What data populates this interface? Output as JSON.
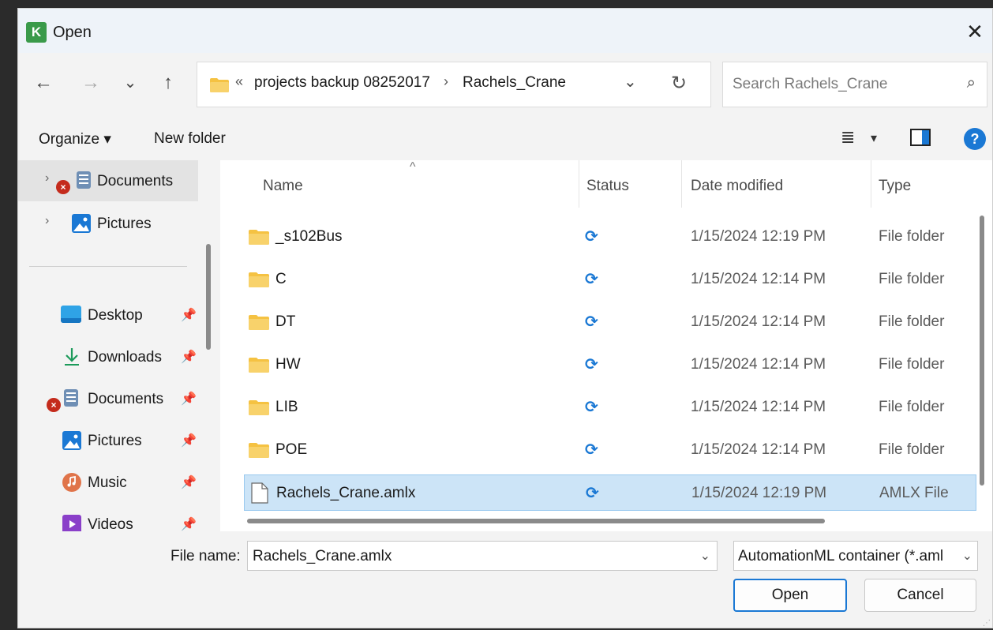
{
  "window": {
    "title": "Open",
    "app_icon_letter": "K",
    "close_glyph": "✕"
  },
  "nav": {
    "back_glyph": "←",
    "forward_glyph": "→",
    "recent_glyph": "⌄",
    "up_glyph": "↑",
    "overflow_glyph": "«",
    "breadcrumbs": [
      "projects backup 08252017",
      "Rachels_Crane"
    ],
    "separator_glyph": "›",
    "dropdown_glyph": "⌄",
    "refresh_glyph": "↻"
  },
  "search": {
    "placeholder": "Search Rachels_Crane",
    "icon_glyph": "⌕"
  },
  "toolbar": {
    "organize_label": "Organize ▾",
    "new_folder_label": "New folder",
    "view_glyph": "≣",
    "view_drop_glyph": "▾",
    "help_glyph": "?"
  },
  "sidebar": {
    "top_items": [
      {
        "label": "Documents",
        "chevron": "›",
        "icon": "documents-icon"
      },
      {
        "label": "Pictures",
        "chevron": "›",
        "icon": "pictures-icon"
      }
    ],
    "quick_access": [
      {
        "label": "Desktop",
        "icon": "desktop-icon"
      },
      {
        "label": "Downloads",
        "icon": "downloads-icon"
      },
      {
        "label": "Documents",
        "icon": "documents-icon"
      },
      {
        "label": "Pictures",
        "icon": "pictures-icon"
      },
      {
        "label": "Music",
        "icon": "music-icon"
      },
      {
        "label": "Videos",
        "icon": "videos-icon"
      }
    ],
    "pin_glyph": "📌",
    "error_glyph": "×"
  },
  "files": {
    "columns": {
      "name": "Name",
      "status": "Status",
      "date": "Date modified",
      "type": "Type"
    },
    "sort_glyph": "^",
    "status_glyph": "⟳",
    "rows": [
      {
        "name": "_s102Bus",
        "date": "1/15/2024 12:19 PM",
        "type": "File folder",
        "kind": "folder"
      },
      {
        "name": "C",
        "date": "1/15/2024 12:14 PM",
        "type": "File folder",
        "kind": "folder"
      },
      {
        "name": "DT",
        "date": "1/15/2024 12:14 PM",
        "type": "File folder",
        "kind": "folder"
      },
      {
        "name": "HW",
        "date": "1/15/2024 12:14 PM",
        "type": "File folder",
        "kind": "folder"
      },
      {
        "name": "LIB",
        "date": "1/15/2024 12:14 PM",
        "type": "File folder",
        "kind": "folder"
      },
      {
        "name": "POE",
        "date": "1/15/2024 12:14 PM",
        "type": "File folder",
        "kind": "folder"
      },
      {
        "name": "Rachels_Crane.amlx",
        "date": "1/15/2024 12:19 PM",
        "type": "AMLX File",
        "kind": "file",
        "selected": true
      }
    ]
  },
  "footer": {
    "file_name_label": "File name:",
    "file_name_value": "Rachels_Crane.amlx",
    "file_name_drop_glyph": "⌄",
    "file_type_value": "AutomationML container (*.aml",
    "file_type_drop_glyph": "⌄",
    "open_label": "Open",
    "cancel_label": "Cancel"
  },
  "colors": {
    "accent": "#1a78d4",
    "folder": "#f5c242",
    "selection": "#cce4f7",
    "error": "#c42b1c"
  }
}
